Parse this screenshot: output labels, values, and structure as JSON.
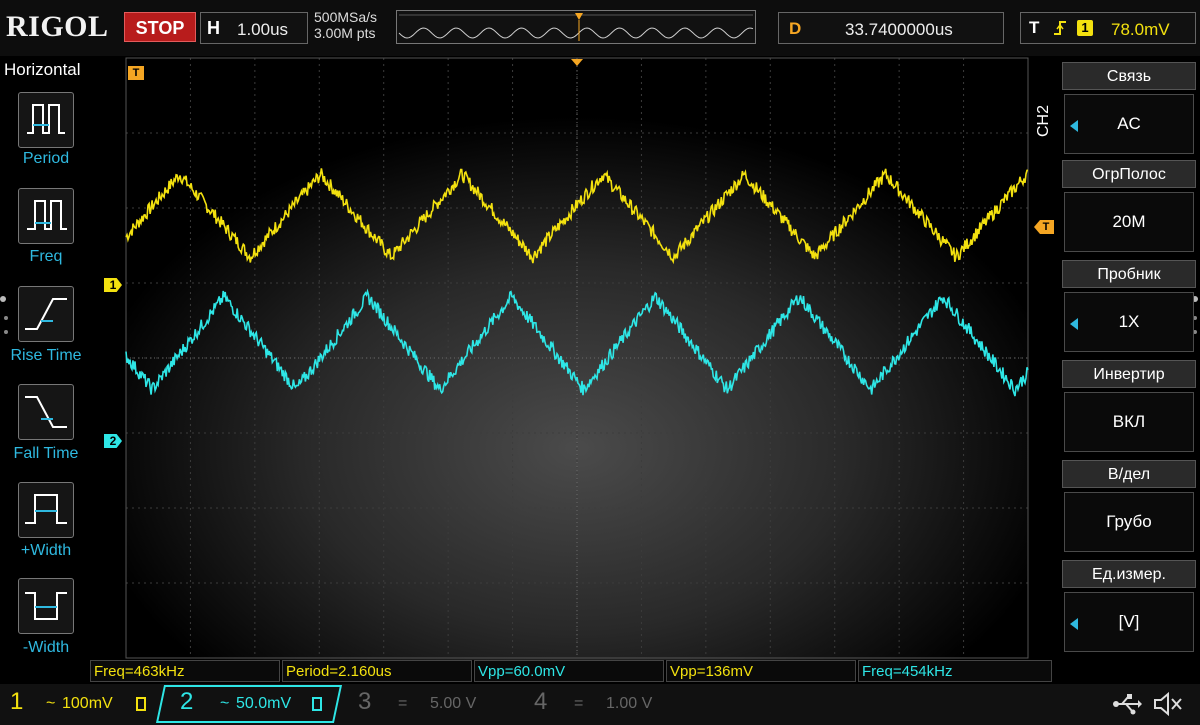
{
  "app": {
    "brand": "RIGOL",
    "run_state": "STOP"
  },
  "timebase": {
    "label": "H",
    "value": "1.00us",
    "sample_rate": "500MSa/s",
    "memory_depth": "3.00M pts"
  },
  "delay": {
    "label": "D",
    "value": "33.7400000us"
  },
  "trigger": {
    "label": "T",
    "edge_icon": "rising-edge-icon",
    "source": "1",
    "level": "78.0mV"
  },
  "left_menu": {
    "title": "Horizontal",
    "items": [
      {
        "label": "Period",
        "icon": "period-icon"
      },
      {
        "label": "Freq",
        "icon": "frequency-icon"
      },
      {
        "label": "Rise Time",
        "icon": "rise-time-icon"
      },
      {
        "label": "Fall Time",
        "icon": "fall-time-icon"
      },
      {
        "label": "+Width",
        "icon": "positive-width-icon"
      },
      {
        "label": "-Width",
        "icon": "negative-width-icon"
      }
    ]
  },
  "right_menu": {
    "channel": "CH2",
    "items": [
      {
        "label": "Связь",
        "value": "AC",
        "arrow": true
      },
      {
        "label": "ОгрПолос",
        "value": "20M",
        "arrow": false
      },
      {
        "label": "Пробник",
        "value": "1X",
        "arrow": true
      },
      {
        "label": "Инвертир",
        "value": "ВКЛ",
        "arrow": false
      },
      {
        "label": "В/дел",
        "value": "Грубо",
        "arrow": false
      },
      {
        "label": "Ед.измер.",
        "value": "[V]",
        "arrow": true
      }
    ]
  },
  "markers": {
    "ch1": "1",
    "ch2": "2",
    "trig_left": "T",
    "trig_right": "T"
  },
  "measurements": [
    {
      "text": "Freq=463kHz",
      "color": "#f3e10f"
    },
    {
      "text": "Period=2.160us",
      "color": "#f3e10f"
    },
    {
      "text": "Vpp=60.0mV",
      "color": "#2ee6e6"
    },
    {
      "text": "Vpp=136mV",
      "color": "#f3e10f"
    },
    {
      "text": "Freq=454kHz",
      "color": "#2ee6e6"
    }
  ],
  "channels": [
    {
      "num": "1",
      "coupling": "~",
      "scale": "100mV",
      "color": "#f3e10f",
      "active": true
    },
    {
      "num": "2",
      "coupling": "~",
      "scale": "50.0mV",
      "color": "#2ee6e6",
      "active": true
    },
    {
      "num": "3",
      "coupling": "=",
      "scale": "5.00 V",
      "color": "#666666",
      "active": false
    },
    {
      "num": "4",
      "coupling": "=",
      "scale": "1.00 V",
      "color": "#666666",
      "active": false
    }
  ],
  "status_icons": [
    "usb-icon",
    "speaker-muted-icon"
  ],
  "colors": {
    "ch1": "#f3e10f",
    "ch2": "#2ee6e6",
    "accent": "#2fb9e0",
    "trigger": "#f5a623",
    "stop": "#b81c1c"
  },
  "chart_data": {
    "type": "line",
    "title": "",
    "xlabel": "",
    "ylabel": "",
    "x_unit": "us",
    "xlim": [
      -6.9,
      6.9
    ],
    "ylim_div": [
      -4,
      4
    ],
    "grid": true,
    "series": [
      {
        "name": "1",
        "period_us": 2.16,
        "waveform": "triangle",
        "offset_div": 1.9,
        "amplitude_div": 0.55,
        "phase_us": -5.0
      },
      {
        "name": "2",
        "period_us": 2.2,
        "waveform": "triangle",
        "offset_div": 0.2,
        "amplitude_div": 0.62,
        "phase_us": -4.3
      }
    ]
  }
}
